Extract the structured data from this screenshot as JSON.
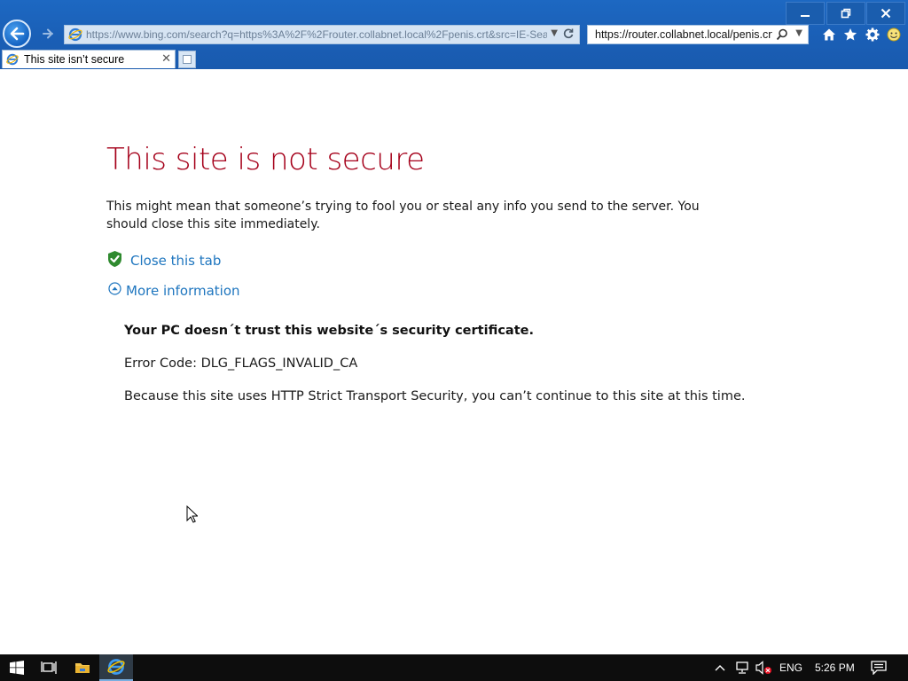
{
  "window": {
    "minimize_icon": "minimize-icon",
    "restore_icon": "restore-icon",
    "close_icon": "close-icon"
  },
  "toolbar": {
    "address_url": "https://www.bing.com/search?q=https%3A%2F%2Frouter.collabnet.local%2Fpenis.crt&src=IE-Sea",
    "search_value": "https://router.collabnet.local/penis.crt",
    "icons": [
      "home-icon",
      "favorites-star-icon",
      "tools-gear-icon",
      "smiley-feedback-icon"
    ]
  },
  "tab": {
    "title": "This site isn’t secure"
  },
  "page": {
    "heading": "This site is not secure",
    "description": "This might mean that someone’s trying to fool you or steal any info you send to the server. You should close this site immediately.",
    "close_tab_label": "Close this tab",
    "more_info_label": "More information",
    "detail_title": "Your PC doesn´t trust this website´s security certificate.",
    "error_code": "Error Code: DLG_FLAGS_INVALID_CA",
    "hsts_message": "Because this site uses HTTP Strict Transport Security, you can’t continue to this site at this time."
  },
  "taskbar": {
    "language": "ENG",
    "time": "5:26 PM"
  },
  "colors": {
    "heading_red": "#a5001a",
    "link_blue": "#1f76bf",
    "chrome_blue": "#1a5fb6"
  }
}
